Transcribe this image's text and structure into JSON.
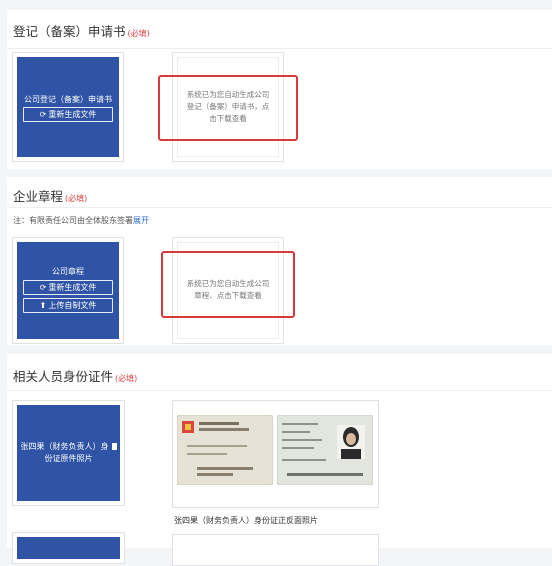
{
  "sections": {
    "registration": {
      "title": "登记（备案）申请书",
      "required": "(必填)",
      "card_title": "公司登记（备案）申请书",
      "regen_label": "重新生成文件",
      "doc_text": [
        "系统已为您自动生成公司",
        "登记（备案）申请书，点",
        "击下载查看"
      ]
    },
    "articles": {
      "title": "企业章程",
      "required": "(必填)",
      "note_prefix": "注：有限责任公司由全体股东签署",
      "note_link": "展开",
      "card_title": "公司章程",
      "regen_label": "重新生成文件",
      "upload_label": "上传自制文件",
      "doc_text": [
        "系统已为您自动生成公司",
        "章程、点击下载查看"
      ]
    },
    "id_docs": {
      "title": "相关人员身份证件",
      "required": "(必填)",
      "card_title_line1": "张四果（财务负责人）身",
      "card_title_line2": "份证原件照片",
      "photo_caption": "张四果（财务负责人）身份证正反面照片"
    }
  },
  "colors": {
    "card_blue": "#2f53a5",
    "highlight_red": "#d63a3a",
    "required_red": "#e64545",
    "link_blue": "#2f6fd6"
  },
  "icons": {
    "regenerate": "refresh-icon",
    "upload": "upload-icon",
    "file": "file-icon"
  }
}
